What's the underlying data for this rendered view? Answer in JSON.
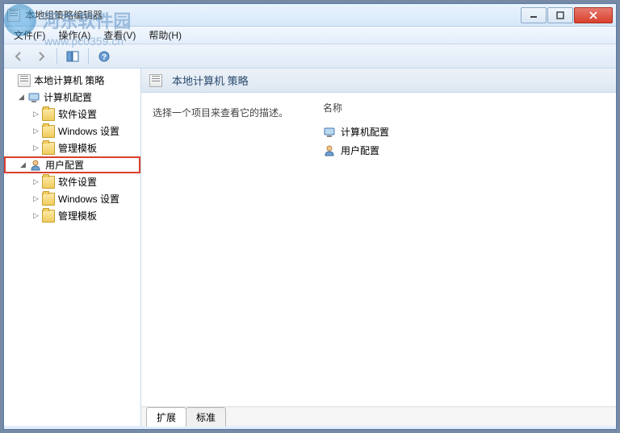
{
  "watermark": {
    "text": "河东软件园",
    "url": "www.pc0359.cn"
  },
  "window": {
    "title": "本地组策略编辑器"
  },
  "menu": {
    "file": "文件(F)",
    "action": "操作(A)",
    "view": "查看(V)",
    "help": "帮助(H)"
  },
  "tree": {
    "root": "本地计算机 策略",
    "computer_config": "计算机配置",
    "user_config": "用户配置",
    "children": {
      "software": "软件设置",
      "windows": "Windows 设置",
      "admin": "管理模板"
    }
  },
  "detail": {
    "header": "本地计算机 策略",
    "description": "选择一个项目来查看它的描述。",
    "column_name": "名称",
    "items": {
      "computer": "计算机配置",
      "user": "用户配置"
    },
    "tabs": {
      "extended": "扩展",
      "standard": "标准"
    }
  }
}
